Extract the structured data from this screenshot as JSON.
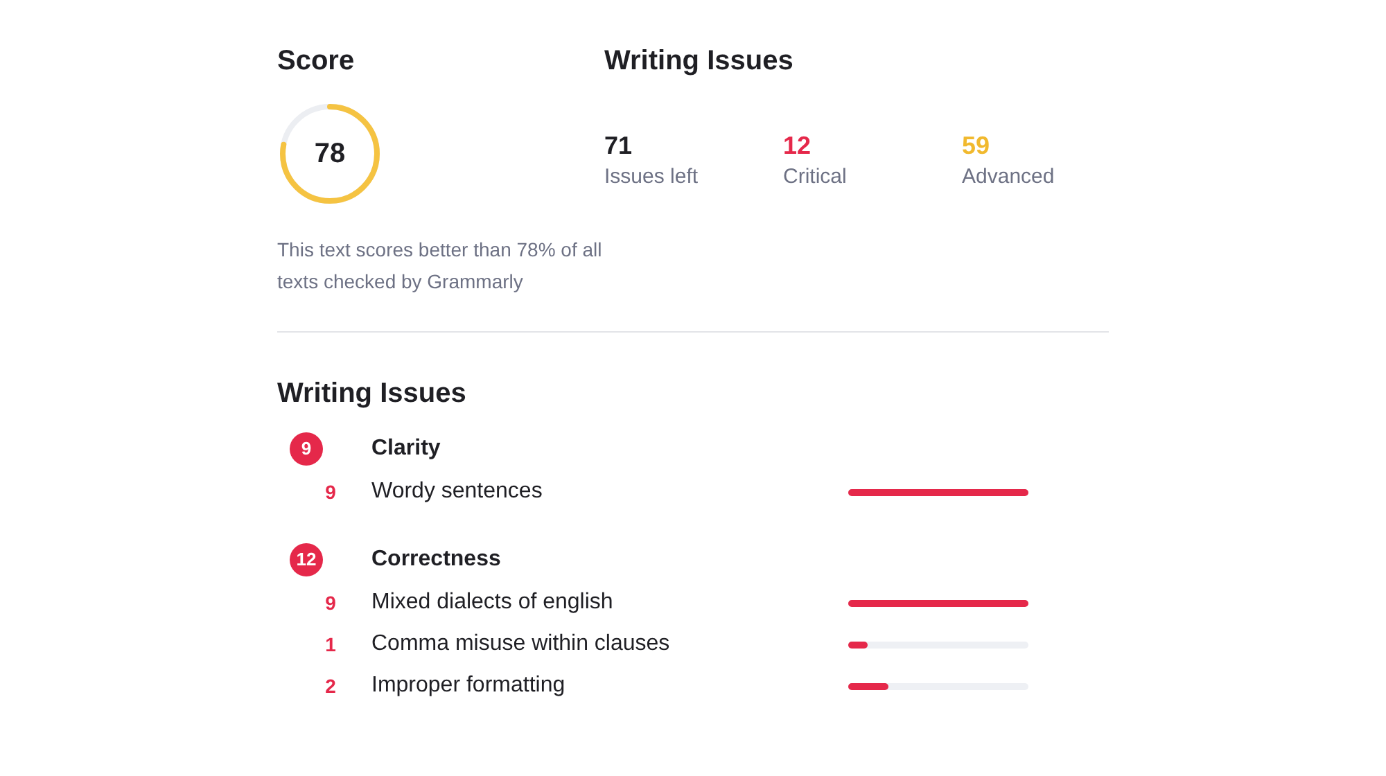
{
  "score": {
    "title": "Score",
    "value": "78",
    "level": 0.78,
    "caption": "This text scores better than 78% of all texts checked by Grammarly"
  },
  "summary": {
    "title": "Writing Issues",
    "stats": [
      {
        "value": "71",
        "label": "Issues left",
        "color": "#1f1f24"
      },
      {
        "value": "12",
        "label": "Critical",
        "color": "#e5284a"
      },
      {
        "value": "59",
        "label": "Advanced",
        "color": "#f1b92e"
      }
    ]
  },
  "issues": {
    "title": "Writing Issues",
    "groups": [
      {
        "count": "9",
        "name": "Clarity",
        "items": [
          {
            "count": "9",
            "name": "Wordy sentences",
            "level": 1
          }
        ]
      },
      {
        "count": "12",
        "name": "Correctness",
        "items": [
          {
            "count": "9",
            "name": "Mixed dialects of english",
            "level": 1
          },
          {
            "count": "1",
            "name": "Comma misuse within clauses",
            "level": 0.11
          },
          {
            "count": "2",
            "name": "Improper formatting",
            "level": 0.22
          }
        ]
      }
    ]
  }
}
